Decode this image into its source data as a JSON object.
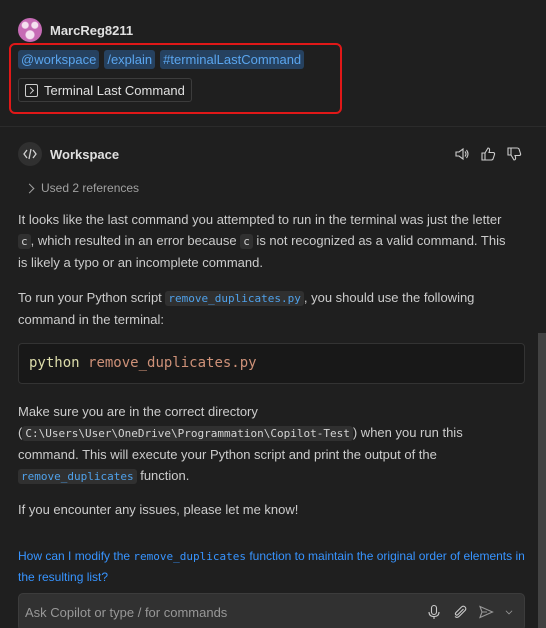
{
  "user": {
    "name": "MarcReg8211",
    "chips": [
      "@workspace",
      "/explain",
      "#terminalLastCommand"
    ],
    "reference": "Terminal Last Command"
  },
  "response": {
    "agent": "Workspace",
    "refs": "Used 2 references",
    "p1": {
      "a": "It looks like the last command you attempted to run in the terminal was just the letter ",
      "c1": "c",
      "b": ", which resulted in an error because ",
      "c2": "c",
      "d": " is not recognized as a valid command. This is likely a typo or an incomplete command."
    },
    "p2": {
      "a": "To run your Python script ",
      "code": "remove_duplicates.py",
      "b": ", you should use the following command in the terminal:"
    },
    "code": {
      "cmd": "python",
      "arg": "remove_duplicates.py"
    },
    "p3": {
      "a": "Make sure you are in the correct directory (",
      "path": "C:\\Users\\User\\OneDrive\\Programmation\\Copilot-Test",
      "b": ") when you run this command. This will execute your Python script and print the output of the ",
      "fn": "remove_duplicates",
      "c": " function."
    },
    "p4": "If you encounter any issues, please let me know!"
  },
  "followup": {
    "a": "How can I modify the ",
    "code": "remove_duplicates",
    "b": " function to maintain the original order of elements in the resulting list?"
  },
  "input": {
    "placeholder": "Ask Copilot or type / for commands"
  },
  "icons": {
    "speaker": "speaker-icon",
    "thumbs_up": "thumbs-up-icon",
    "thumbs_down": "thumbs-down-icon",
    "mic": "microphone-icon",
    "attach": "paperclip-icon",
    "send": "send-icon"
  }
}
